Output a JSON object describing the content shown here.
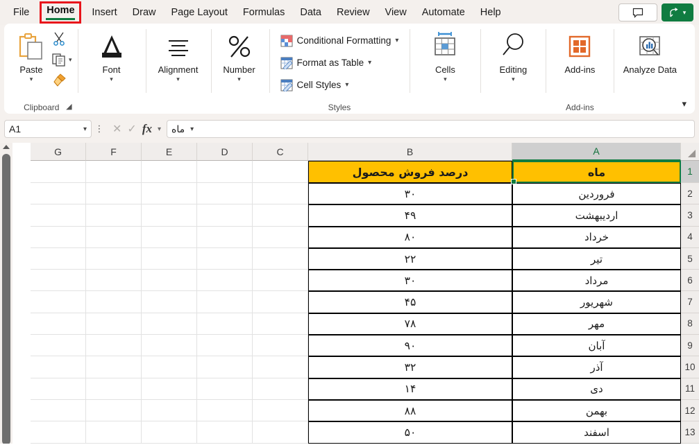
{
  "window": {
    "app": "Microsoft Excel"
  },
  "tabs": {
    "items": [
      {
        "label": "File",
        "active": false
      },
      {
        "label": "Home",
        "active": true
      },
      {
        "label": "Insert",
        "active": false
      },
      {
        "label": "Draw",
        "active": false
      },
      {
        "label": "Page Layout",
        "active": false
      },
      {
        "label": "Formulas",
        "active": false
      },
      {
        "label": "Data",
        "active": false
      },
      {
        "label": "Review",
        "active": false
      },
      {
        "label": "View",
        "active": false
      },
      {
        "label": "Automate",
        "active": false
      },
      {
        "label": "Help",
        "active": false
      }
    ],
    "highlight_color": "#e8141b",
    "active_underline_color": "#107c41",
    "comments_button": "comment-icon",
    "share_button": "Share"
  },
  "ribbon": {
    "groups": [
      {
        "caption": "Clipboard",
        "paste_label": "Paste",
        "cut_label": "Cut",
        "copy_label": "Copy",
        "format_painter_label": "Format Painter",
        "dialog_launcher": "Clipboard settings"
      },
      {
        "caption": "",
        "label": "Font"
      },
      {
        "caption": "",
        "label": "Alignment"
      },
      {
        "caption": "",
        "label": "Number"
      },
      {
        "caption": "Styles",
        "items": [
          "Conditional Formatting",
          "Format as Table",
          "Cell Styles"
        ]
      },
      {
        "caption": "",
        "label": "Cells"
      },
      {
        "caption": "",
        "label": "Editing"
      },
      {
        "caption": "Add-ins",
        "label": "Add-ins"
      },
      {
        "caption": "",
        "label": "Analyze Data"
      }
    ],
    "collapse_icon": "chevron-down-icon"
  },
  "formula_bar": {
    "name_box_value": "A1",
    "name_box_chevron": "chevron-down-icon",
    "cancel_icon": "cancel-icon",
    "enter_icon": "check-icon",
    "function_icon": "fx",
    "function_chevron": "chevron-down-icon",
    "formula_value": "ماه",
    "expand_chevron": "chevron-down-icon"
  },
  "sheet": {
    "columns": [
      "A",
      "B",
      "C",
      "D",
      "E",
      "F",
      "G"
    ],
    "selected_column": "A",
    "selected_cell": "A1",
    "rows": [
      "1",
      "2",
      "3",
      "4",
      "5",
      "6",
      "7",
      "8",
      "9",
      "10",
      "11",
      "12",
      "13"
    ],
    "selected_row": "1",
    "header_fill_color": "#ffc000",
    "selection_border_color": "#107c41",
    "headers": {
      "A": "ماه",
      "B": "درصد فروش محصول"
    },
    "data": [
      {
        "row": "2",
        "month": "فروردین",
        "percent": "۳۰"
      },
      {
        "row": "3",
        "month": "اردیبهشت",
        "percent": "۴۹"
      },
      {
        "row": "4",
        "month": "خرداد",
        "percent": "۸۰"
      },
      {
        "row": "5",
        "month": "تیر",
        "percent": "۲۲"
      },
      {
        "row": "6",
        "month": "مرداد",
        "percent": "۳۰"
      },
      {
        "row": "7",
        "month": "شهریور",
        "percent": "۴۵"
      },
      {
        "row": "8",
        "month": "مهر",
        "percent": "۷۸"
      },
      {
        "row": "9",
        "month": "آبان",
        "percent": "۹۰"
      },
      {
        "row": "10",
        "month": "آذر",
        "percent": "۳۲"
      },
      {
        "row": "11",
        "month": "دی",
        "percent": "۱۴"
      },
      {
        "row": "12",
        "month": "بهمن",
        "percent": "۸۸"
      },
      {
        "row": "13",
        "month": "اسفند",
        "percent": "۵۰"
      }
    ]
  }
}
